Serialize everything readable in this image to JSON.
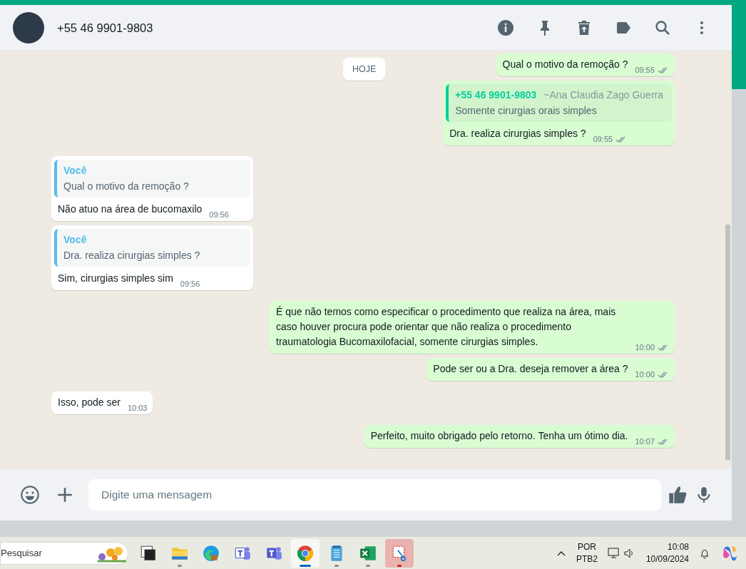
{
  "header": {
    "contact": "+55 46 9901-9803"
  },
  "date_chip": "HOJE",
  "messages": [
    {
      "kind": "out",
      "text": "Qual o motivo da remoção ?",
      "time": "09:55"
    },
    {
      "kind": "out",
      "quote": {
        "author": "+55 46 9901-9803",
        "author_note": "~Ana Claudia Zago Guerra",
        "text": "Somente cirurgias orais simples"
      },
      "text": "Dra. realiza cirurgias simples ?",
      "time": "09:55"
    },
    {
      "kind": "in",
      "quote": {
        "author": "Você",
        "text": "Qual o motivo da remoção ?"
      },
      "text": "Não atuo na área de bucomaxilo",
      "time": "09:56"
    },
    {
      "kind": "in",
      "quote": {
        "author": "Você",
        "text": "Dra. realiza cirurgias simples ?"
      },
      "text": "Sim, cirurgias simples sim",
      "time": "09:56"
    },
    {
      "kind": "out",
      "text": "É que não temos como especificar o procedimento que realiza na área, mais caso houver procura pode orientar que não realiza o procedimento traumatologia Bucomaxilofacial, somente cirurgias simples.",
      "time": "10:00"
    },
    {
      "kind": "out",
      "text": "Pode ser ou a Dra. deseja remover a área ?",
      "time": "10:00"
    },
    {
      "kind": "in",
      "text": "Isso, pode ser",
      "time": "10:03"
    },
    {
      "kind": "out",
      "text": "Perfeito, muito obrigado pelo retorno. Tenha um ótimo dia.",
      "time": "10:07"
    }
  ],
  "composer": {
    "placeholder": "Digite uma mensagem"
  },
  "taskbar": {
    "search_placeholder": "Pesquisar",
    "apps": [
      {
        "kind": "taskview",
        "selected": false,
        "running": false,
        "attention": false
      },
      {
        "kind": "files",
        "selected": false,
        "running": true,
        "attention": false
      },
      {
        "kind": "edge",
        "selected": false,
        "running": false,
        "attention": false
      },
      {
        "kind": "teams",
        "selected": false,
        "running": false,
        "attention": false
      },
      {
        "kind": "teams2",
        "selected": false,
        "running": false,
        "attention": false
      },
      {
        "kind": "chrome",
        "selected": true,
        "running": true,
        "attention": false
      },
      {
        "kind": "notepad",
        "selected": false,
        "running": true,
        "attention": false
      },
      {
        "kind": "excel",
        "selected": false,
        "running": true,
        "attention": false
      },
      {
        "kind": "snip",
        "selected": false,
        "running": true,
        "attention": true
      }
    ],
    "language": "POR",
    "layout": "PTB2",
    "clock_time": "10:08",
    "clock_date": "10/09/2024"
  }
}
